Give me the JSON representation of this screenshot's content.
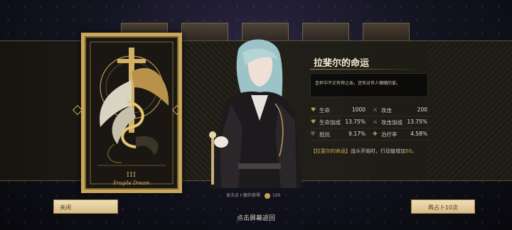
{
  "card": {
    "numeral": "III",
    "name": "Fragile Dream"
  },
  "info": {
    "title": "拉斐尔的命运",
    "description": "圣杯中不正有神之血，还有对世人嘲嘲的爱。"
  },
  "stats": [
    {
      "icon": "heart-icon",
      "label": "生命",
      "value": "1000"
    },
    {
      "icon": "sword-icon",
      "label": "攻击",
      "value": "200"
    },
    {
      "icon": "heart-plus-icon",
      "label": "生命加成",
      "value": "13.75%"
    },
    {
      "icon": "sword-plus-icon",
      "label": "攻击加成",
      "value": "13.75%"
    },
    {
      "icon": "shield-icon",
      "label": "抵抗",
      "value": "9.17%"
    },
    {
      "icon": "heal-icon",
      "label": "治疗率",
      "value": "4.58%"
    }
  ],
  "effect": {
    "name": "【拉斐尔的命运】",
    "text": "战斗开始时，行动值增加",
    "amount": "50",
    "end": "。"
  },
  "bottom": {
    "info_text": "本次点卜额外获得",
    "coin_amount": "100",
    "close_label": "关闭",
    "ten_label": "再占卜10次",
    "tap_return": "点击屏幕返回"
  },
  "colors": {
    "gold": "#c9a659",
    "highlight": "#d9b461",
    "panel": "#23211a"
  }
}
